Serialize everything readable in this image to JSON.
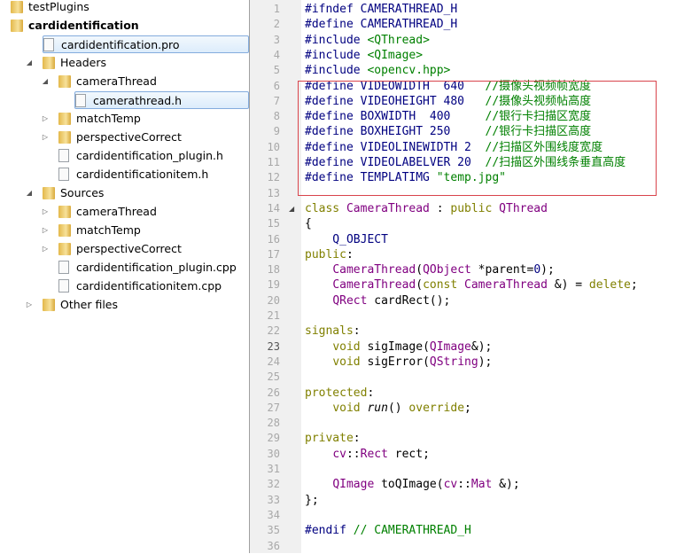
{
  "project_tree": {
    "items": [
      {
        "label": "testPlugins",
        "depth": 0,
        "arrow": "",
        "icon": "qml-project-icon",
        "bold": false,
        "selected": false
      },
      {
        "label": "cardidentification",
        "depth": 0,
        "arrow": "",
        "icon": "qt-project-icon",
        "bold": true,
        "selected": false
      },
      {
        "label": "cardidentification.pro",
        "depth": 1,
        "arrow": "",
        "icon": "pro-file-icon",
        "bold": false,
        "selected": true
      },
      {
        "label": "Headers",
        "depth": 1,
        "arrow": "expanded",
        "icon": "headers-folder-icon",
        "bold": false,
        "selected": false
      },
      {
        "label": "cameraThread",
        "depth": 2,
        "arrow": "expanded",
        "icon": "folder-icon",
        "bold": false,
        "selected": false
      },
      {
        "label": "camerathread.h",
        "depth": 3,
        "arrow": "",
        "icon": "file-icon",
        "bold": false,
        "selected": true
      },
      {
        "label": "matchTemp",
        "depth": 2,
        "arrow": "collapsed",
        "icon": "folder-icon",
        "bold": false,
        "selected": false
      },
      {
        "label": "perspectiveCorrect",
        "depth": 2,
        "arrow": "collapsed",
        "icon": "folder-icon",
        "bold": false,
        "selected": false
      },
      {
        "label": "cardidentification_plugin.h",
        "depth": 2,
        "arrow": "",
        "icon": "file-icon",
        "bold": false,
        "selected": false
      },
      {
        "label": "cardidentificationitem.h",
        "depth": 2,
        "arrow": "",
        "icon": "file-icon",
        "bold": false,
        "selected": false
      },
      {
        "label": "Sources",
        "depth": 1,
        "arrow": "expanded",
        "icon": "sources-folder-icon",
        "bold": false,
        "selected": false
      },
      {
        "label": "cameraThread",
        "depth": 2,
        "arrow": "collapsed",
        "icon": "folder-icon",
        "bold": false,
        "selected": false
      },
      {
        "label": "matchTemp",
        "depth": 2,
        "arrow": "collapsed",
        "icon": "folder-icon",
        "bold": false,
        "selected": false
      },
      {
        "label": "perspectiveCorrect",
        "depth": 2,
        "arrow": "collapsed",
        "icon": "folder-icon",
        "bold": false,
        "selected": false
      },
      {
        "label": "cardidentification_plugin.cpp",
        "depth": 2,
        "arrow": "",
        "icon": "file-icon",
        "bold": false,
        "selected": false
      },
      {
        "label": "cardidentificationitem.cpp",
        "depth": 2,
        "arrow": "",
        "icon": "file-icon",
        "bold": false,
        "selected": false
      },
      {
        "label": "Other files",
        "depth": 1,
        "arrow": "collapsed",
        "icon": "other-files-icon",
        "bold": false,
        "selected": false
      }
    ]
  },
  "editor": {
    "current_line": 23,
    "fold_line": 14,
    "highlight_color": "#d9444c",
    "lines": [
      [
        [
          "#ifndef CAMERATHREAD_H",
          "p"
        ]
      ],
      [
        [
          "#define CAMERATHREAD_H",
          "p"
        ]
      ],
      [
        [
          "#include ",
          "p"
        ],
        [
          "<QThread>",
          "s"
        ]
      ],
      [
        [
          "#include ",
          "p"
        ],
        [
          "<QImage>",
          "s"
        ]
      ],
      [
        [
          "#include ",
          "p"
        ],
        [
          "<opencv.hpp>",
          "s"
        ]
      ],
      [
        [
          "#define VIDEOWIDTH  640   ",
          "p"
        ],
        [
          "//摄像头视频帧宽度",
          "c"
        ]
      ],
      [
        [
          "#define VIDEOHEIGHT 480   ",
          "p"
        ],
        [
          "//摄像头视频帖高度",
          "c"
        ]
      ],
      [
        [
          "#define BOXWIDTH  400     ",
          "p"
        ],
        [
          "//银行卡扫描区宽度",
          "c"
        ]
      ],
      [
        [
          "#define BOXHEIGHT 250     ",
          "p"
        ],
        [
          "//银行卡扫描区高度",
          "c"
        ]
      ],
      [
        [
          "#define VIDEOLINEWIDTH 2  ",
          "p"
        ],
        [
          "//扫描区外围线度宽度",
          "c"
        ]
      ],
      [
        [
          "#define VIDEOLABELVER 20  ",
          "p"
        ],
        [
          "//扫描区外围线条垂直高度",
          "c"
        ]
      ],
      [
        [
          "#define TEMPLATIMG ",
          "p"
        ],
        [
          "\"temp.jpg\"",
          "s"
        ]
      ],
      [],
      [
        [
          "class ",
          "k"
        ],
        [
          "CameraThread",
          "t"
        ],
        [
          " : ",
          "n"
        ],
        [
          "public ",
          "k"
        ],
        [
          "QThread",
          "t"
        ]
      ],
      [
        [
          "{",
          "n"
        ]
      ],
      [
        [
          "    Q_OBJECT",
          "m"
        ]
      ],
      [
        [
          "public",
          "k"
        ],
        [
          ":",
          "n"
        ]
      ],
      [
        [
          "    ",
          "n"
        ],
        [
          "CameraThread",
          "t"
        ],
        [
          "(",
          "n"
        ],
        [
          "QObject",
          "t"
        ],
        [
          " *parent=",
          "n"
        ],
        [
          "0",
          "m"
        ],
        [
          ");",
          "n"
        ]
      ],
      [
        [
          "    ",
          "n"
        ],
        [
          "CameraThread",
          "t"
        ],
        [
          "(",
          "n"
        ],
        [
          "const ",
          "k"
        ],
        [
          "CameraThread",
          "t"
        ],
        [
          " &) = ",
          "n"
        ],
        [
          "delete",
          "k"
        ],
        [
          ";",
          "n"
        ]
      ],
      [
        [
          "    ",
          "n"
        ],
        [
          "QRect",
          "t"
        ],
        [
          " cardRect();",
          "n"
        ]
      ],
      [],
      [
        [
          "signals",
          "k"
        ],
        [
          ":",
          "n"
        ]
      ],
      [
        [
          "    ",
          "n"
        ],
        [
          "void ",
          "k"
        ],
        [
          "sigImage(",
          "n"
        ],
        [
          "QImage",
          "t"
        ],
        [
          "&);",
          "n"
        ]
      ],
      [
        [
          "    ",
          "n"
        ],
        [
          "void ",
          "k"
        ],
        [
          "sigError(",
          "n"
        ],
        [
          "QString",
          "t"
        ],
        [
          ");",
          "n"
        ]
      ],
      [],
      [
        [
          "protected",
          "k"
        ],
        [
          ":",
          "n"
        ]
      ],
      [
        [
          "    ",
          "n"
        ],
        [
          "void ",
          "k"
        ],
        [
          "run",
          "i"
        ],
        [
          "() ",
          "n"
        ],
        [
          "override",
          "k"
        ],
        [
          ";",
          "n"
        ]
      ],
      [],
      [
        [
          "private",
          "k"
        ],
        [
          ":",
          "n"
        ]
      ],
      [
        [
          "    ",
          "n"
        ],
        [
          "cv",
          "t"
        ],
        [
          "::",
          "n"
        ],
        [
          "Rect",
          "t"
        ],
        [
          " rect;",
          "n"
        ]
      ],
      [],
      [
        [
          "    ",
          "n"
        ],
        [
          "QImage",
          "t"
        ],
        [
          " toQImage(",
          "n"
        ],
        [
          "cv",
          "t"
        ],
        [
          "::",
          "n"
        ],
        [
          "Mat",
          "t"
        ],
        [
          " &);",
          "n"
        ]
      ],
      [
        [
          "};",
          "n"
        ]
      ],
      [],
      [
        [
          "#endif ",
          "p"
        ],
        [
          "// CAMERATHREAD_H",
          "c"
        ]
      ],
      []
    ]
  }
}
